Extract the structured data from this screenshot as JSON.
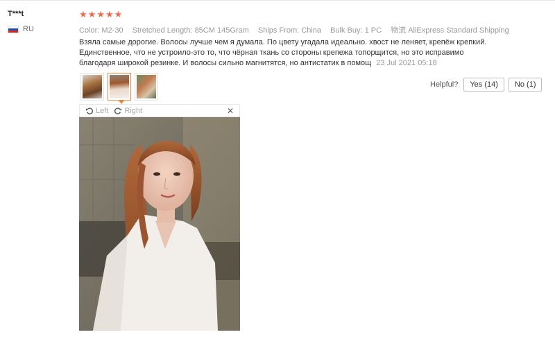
{
  "review": {
    "username": "T***t",
    "country": "RU",
    "rating": 5,
    "meta": [
      {
        "key": "Color:",
        "value": "M2-30"
      },
      {
        "key": "Stretched Length:",
        "value": "85CM 145Gram"
      },
      {
        "key": "Ships From:",
        "value": "China"
      },
      {
        "key": "Bulk Buy:",
        "value": "1 PC"
      },
      {
        "key": "物流",
        "value": "AliExpress Standard Shipping"
      }
    ],
    "text": "Взяла самые дорогие. Волосы лучше чем я думала. По цвету угадала идеально. хвост не леняет, крепёж крепкий. Единственное, что не устроило-это то, что чёрная ткань со стороны крепежа топорщится, но это исправимо благодаря широкой резинке. И волосы сильно магнитятся, но антистатик в помощ",
    "date": "23 Jul 2021 05:18"
  },
  "helpful": {
    "label": "Helpful?",
    "yes_label": "Yes (14)",
    "no_label": "No (1)"
  },
  "viewer": {
    "left_label": "Left",
    "right_label": "Right",
    "close_glyph": "✕"
  },
  "thumbnails": {
    "count": 3,
    "active_index": 1
  },
  "colors": {
    "star": "#f26a4b",
    "active_thumb": "#e8883c",
    "meta_text": "#999999"
  },
  "icons": [
    "flag-ru-icon",
    "star-icon",
    "rotate-left-icon",
    "rotate-right-icon",
    "close-icon"
  ]
}
